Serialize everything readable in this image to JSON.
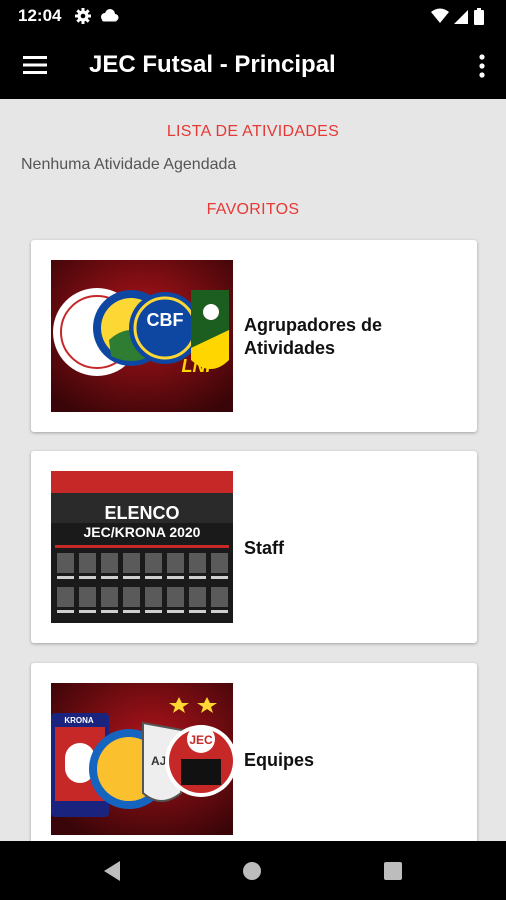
{
  "status_bar": {
    "time": "12:04",
    "left_icons": [
      "gear-icon",
      "cloud-icon"
    ],
    "right_icons": [
      "wifi-icon",
      "signal-icon",
      "battery-icon"
    ]
  },
  "app_bar": {
    "title": "JEC Futsal - Principal",
    "menu_icon": "menu-icon",
    "overflow_icon": "more-vert-icon"
  },
  "main": {
    "activities_heading": "LISTA DE ATIVIDADES",
    "activities_empty": "Nenhuma Atividade Agendada",
    "favorites_heading": "FAVORITOS",
    "favorites": [
      {
        "label": "Agrupadores de Atividades",
        "thumb_text": [
          "CBF",
          "LNF"
        ]
      },
      {
        "label": "Staff",
        "thumb_text": [
          "ELENCO",
          "JEC/KRONA 2020"
        ]
      },
      {
        "label": "Equipes",
        "thumb_text": [
          "KRONA",
          "AJH",
          "JEC"
        ]
      }
    ]
  },
  "nav_bar": {
    "buttons": [
      "back-icon",
      "home-icon",
      "recents-icon"
    ]
  },
  "colors": {
    "accent": "#e53935",
    "bars": "#000000",
    "background": "#e6e6e6",
    "card": "#ffffff"
  }
}
